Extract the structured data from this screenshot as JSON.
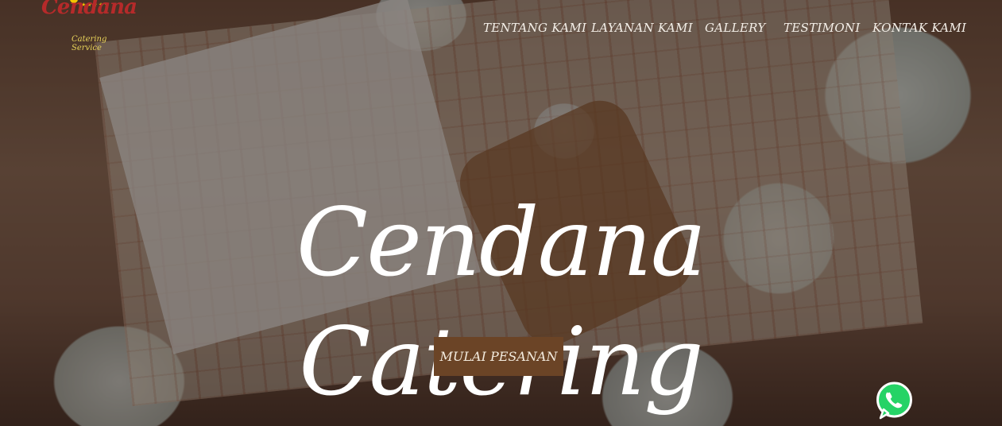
{
  "brand": {
    "name": "Cendana",
    "stars": "★★★★★",
    "tagline": "Catering Service"
  },
  "nav": {
    "items": [
      "TENTANG KAMI",
      "LAYANAN KAMI",
      "GALLERY",
      "TESTIMONI",
      "KONTAK KAMI"
    ]
  },
  "hero": {
    "title": "Cendana Catering",
    "cta_label": "MULAI PESANAN"
  },
  "icons": {
    "floating_contact": "whatsapp-icon",
    "logo_mark": "sun-icon"
  },
  "colors": {
    "cta_background": "#6b4426",
    "nav_text": "#f4efe8",
    "whatsapp_green": "#25d366",
    "logo_red": "#b52a2a",
    "logo_gold": "#e8d35a"
  }
}
